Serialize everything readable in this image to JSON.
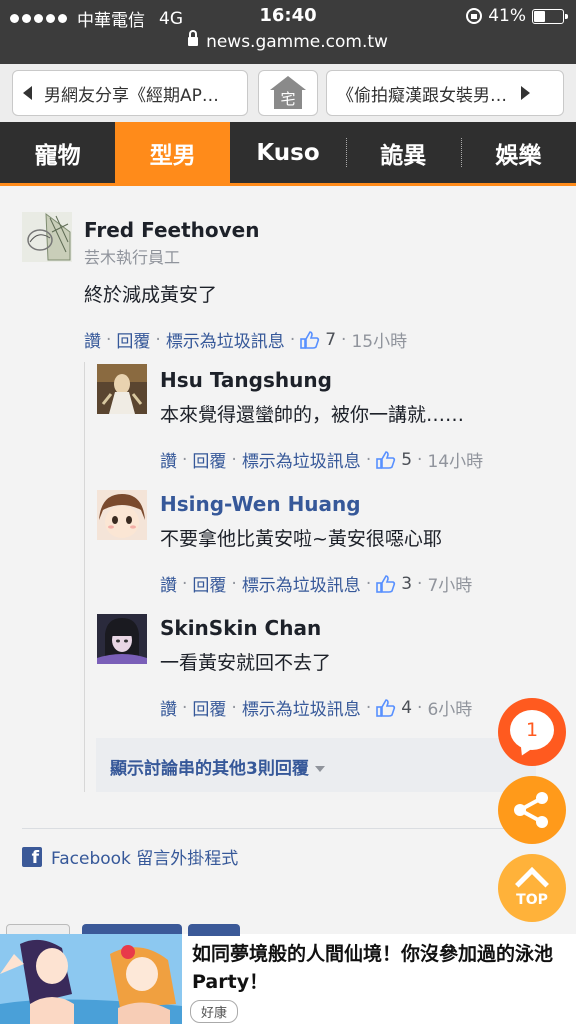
{
  "status_bar": {
    "carrier": "中華電信",
    "network": "4G",
    "time": "16:40",
    "battery": "41%",
    "battery_level": 0.41,
    "url": "news.gamme.com.tw"
  },
  "nav": {
    "prev_label": "男網友分享《經期AP…",
    "home_label": "宅",
    "next_label": "《偷拍癡漢跟女裝男…"
  },
  "categories": [
    "寵物",
    "型男",
    "Kuso",
    "詭異",
    "娛樂"
  ],
  "active_category": "型男",
  "actions": {
    "like": "讚",
    "reply": "回覆",
    "spam": "標示為垃圾訊息"
  },
  "comment": {
    "author": "Fred Feethoven",
    "subtitle": "芸木執行員工",
    "text": "終於減成黃安了",
    "likes": "7",
    "time": "15小時"
  },
  "replies": [
    {
      "author": "Hsu Tangshung",
      "text": "本來覺得還蠻帥的，被你一講就……",
      "likes": "5",
      "time": "14小時"
    },
    {
      "author": "Hsing-Wen Huang",
      "text": "不要拿他比黃安啦~黃安很噁心耶",
      "likes": "3",
      "time": "7小時"
    },
    {
      "author": "SkinSkin Chan",
      "text": "一看黃安就回不去了",
      "likes": "4",
      "time": "6小時"
    }
  ],
  "more_replies": "顯示討論串的其他3則回覆",
  "facebook_plugin": "Facebook 留言外掛程式",
  "floating": {
    "comment_count": "1",
    "top_label": "TOP"
  },
  "ad": {
    "title": "如同夢境般的人間仙境！你沒參加過的泳池Party！",
    "source": "好康"
  },
  "colors": {
    "accent": "#ff8b1a",
    "fb_blue": "#365899",
    "cat_bar": "#2f2f2f"
  }
}
